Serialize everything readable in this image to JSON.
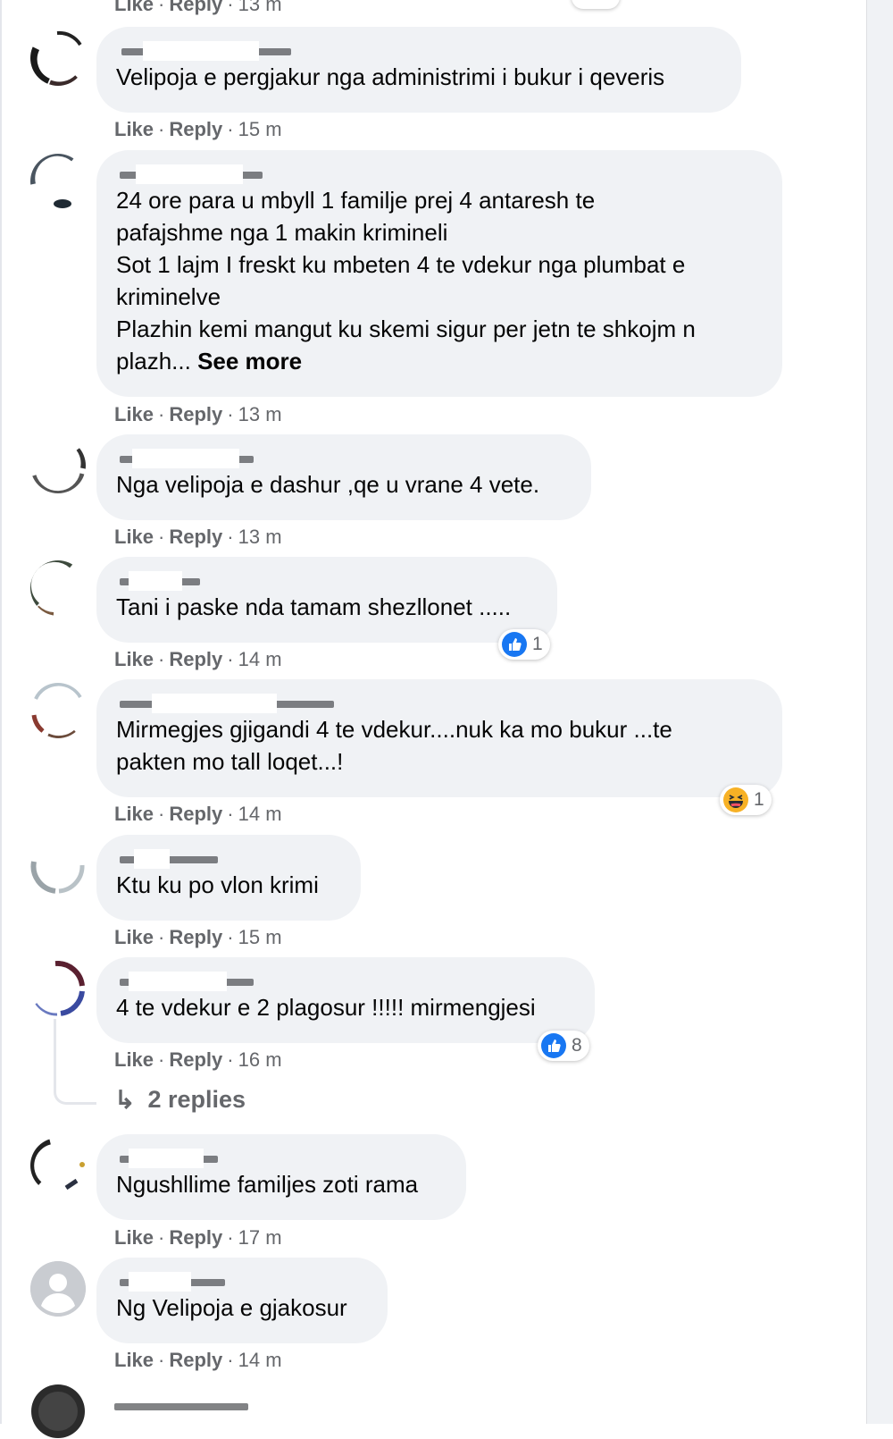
{
  "colors": {
    "bubble": "#f0f2f5",
    "meta": "#65676b",
    "text": "#050505",
    "like_blue": "#1877f2",
    "haha_yellow": "#f7b125"
  },
  "top_meta": {
    "like": "Like",
    "reply": "Reply",
    "time": "13 m"
  },
  "comments": [
    {
      "text": "Velipoja e pergjakur nga administrimi i bukur i qeveris",
      "like": "Like",
      "reply": "Reply",
      "time": "15 m"
    },
    {
      "text": "24 ore para u mbyll 1 familje prej 4 antaresh te\npafajshme nga 1 makin krimineli\nSot 1 lajm I freskt ku mbeten 4 te vdekur nga plumbat e\nkriminelve\nPlazhin kemi mangut ku skemi sigur per jetn te shkojm n\nplazh... ",
      "see_more": "See more",
      "like": "Like",
      "reply": "Reply",
      "time": "13 m"
    },
    {
      "text": "Nga velipoja e dashur ,qe u vrane 4 vete.",
      "like": "Like",
      "reply": "Reply",
      "time": "13 m"
    },
    {
      "text": "Tani i paske nda tamam shezllonet .....",
      "like": "Like",
      "reply": "Reply",
      "time": "14 m",
      "reaction": {
        "type": "like-icon",
        "count": "1"
      }
    },
    {
      "text": "Mirmegjes gjigandi 4 te vdekur....nuk ka mo bukur ...te\npakten mo tall loqet...!",
      "like": "Like",
      "reply": "Reply",
      "time": "14 m",
      "reaction": {
        "type": "haha-icon",
        "count": "1"
      }
    },
    {
      "text": "Ktu ku po vlon krimi",
      "like": "Like",
      "reply": "Reply",
      "time": "15 m"
    },
    {
      "text": "4 te vdekur e 2 plagosur !!!!! mirmengjesi",
      "like": "Like",
      "reply": "Reply",
      "time": "16 m",
      "reaction": {
        "type": "like-icon",
        "count": "8"
      },
      "replies_label": "2 replies"
    },
    {
      "text": "Ngushllime familjes zoti rama",
      "like": "Like",
      "reply": "Reply",
      "time": "17 m"
    },
    {
      "text": "Ng Velipoja e gjakosur",
      "like": "Like",
      "reply": "Reply",
      "time": "14 m"
    }
  ]
}
